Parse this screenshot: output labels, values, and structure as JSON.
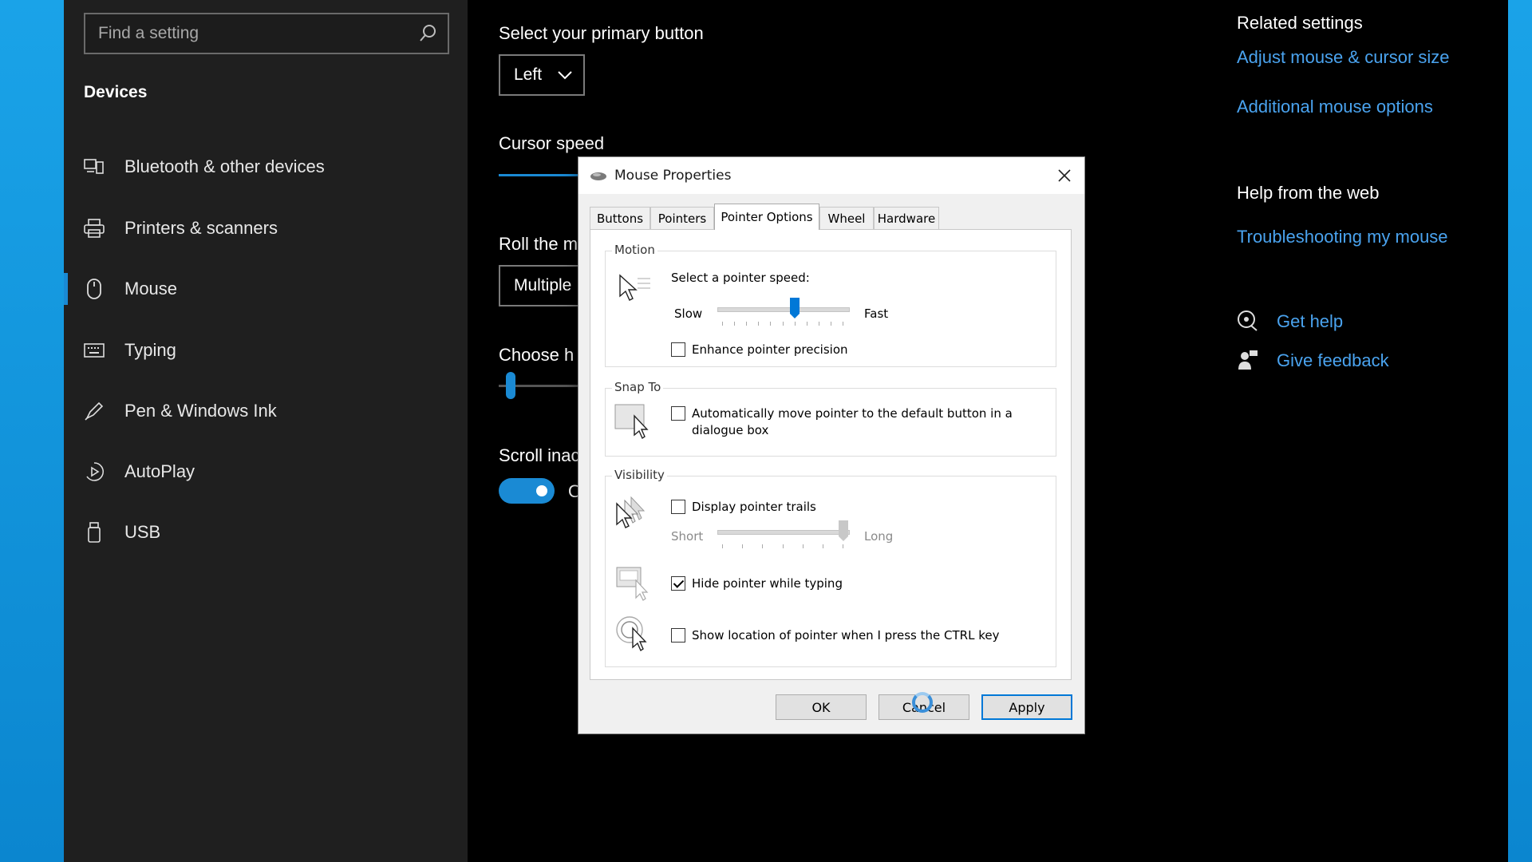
{
  "search": {
    "placeholder": "Find a setting"
  },
  "sidebar": {
    "heading": "Devices",
    "items": [
      {
        "label": "Bluetooth & other devices",
        "icon": "bluetooth-devices-icon"
      },
      {
        "label": "Printers & scanners",
        "icon": "printer-icon"
      },
      {
        "label": "Mouse",
        "icon": "mouse-icon",
        "selected": true
      },
      {
        "label": "Typing",
        "icon": "keyboard-icon"
      },
      {
        "label": "Pen & Windows Ink",
        "icon": "pen-icon"
      },
      {
        "label": "AutoPlay",
        "icon": "autoplay-icon"
      },
      {
        "label": "USB",
        "icon": "usb-icon"
      }
    ]
  },
  "main": {
    "primary_button_label": "Select your primary button",
    "primary_button_value": "Left",
    "cursor_speed_label": "Cursor speed",
    "roll_label_partial": "Roll the m",
    "roll_value_partial": "Multiple",
    "choose_label_partial": "Choose h",
    "scroll_label_partial": "Scroll inac",
    "scroll_toggle_on": true,
    "toggle_state_partial": "O"
  },
  "right": {
    "related_heading": "Related settings",
    "link_adjust": "Adjust mouse & cursor size",
    "link_additional": "Additional mouse options",
    "help_heading": "Help from the web",
    "link_troubleshoot": "Troubleshooting my mouse",
    "get_help": "Get help",
    "give_feedback": "Give feedback"
  },
  "dialog": {
    "title": "Mouse Properties",
    "tabs": [
      "Buttons",
      "Pointers",
      "Pointer Options",
      "Wheel",
      "Hardware"
    ],
    "active_tab": "Pointer Options",
    "motion": {
      "group_label": "Motion",
      "prompt": "Select a pointer speed:",
      "slow": "Slow",
      "fast": "Fast",
      "speed_fraction": 0.6,
      "enhance_label": "Enhance pointer precision",
      "enhance_checked": false
    },
    "snap": {
      "group_label": "Snap To",
      "label_line1": "Automatically move pointer to the default button in a",
      "label_line2": "dialogue box",
      "checked": false
    },
    "visibility": {
      "group_label": "Visibility",
      "trails_label": "Display pointer trails",
      "trails_checked": false,
      "short": "Short",
      "long": "Long",
      "trail_fraction": 1.0,
      "hide_label": "Hide pointer while typing",
      "hide_checked": true,
      "show_label": "Show location of pointer when I press the CTRL key",
      "show_checked": false
    },
    "buttons": {
      "ok": "OK",
      "cancel": "Cancel",
      "apply": "Apply"
    }
  },
  "colors": {
    "accent": "#1a8ad4",
    "link": "#4aa3ef",
    "sidebar_bg": "#1f1f1f",
    "desktop": "#0a8fd6"
  }
}
